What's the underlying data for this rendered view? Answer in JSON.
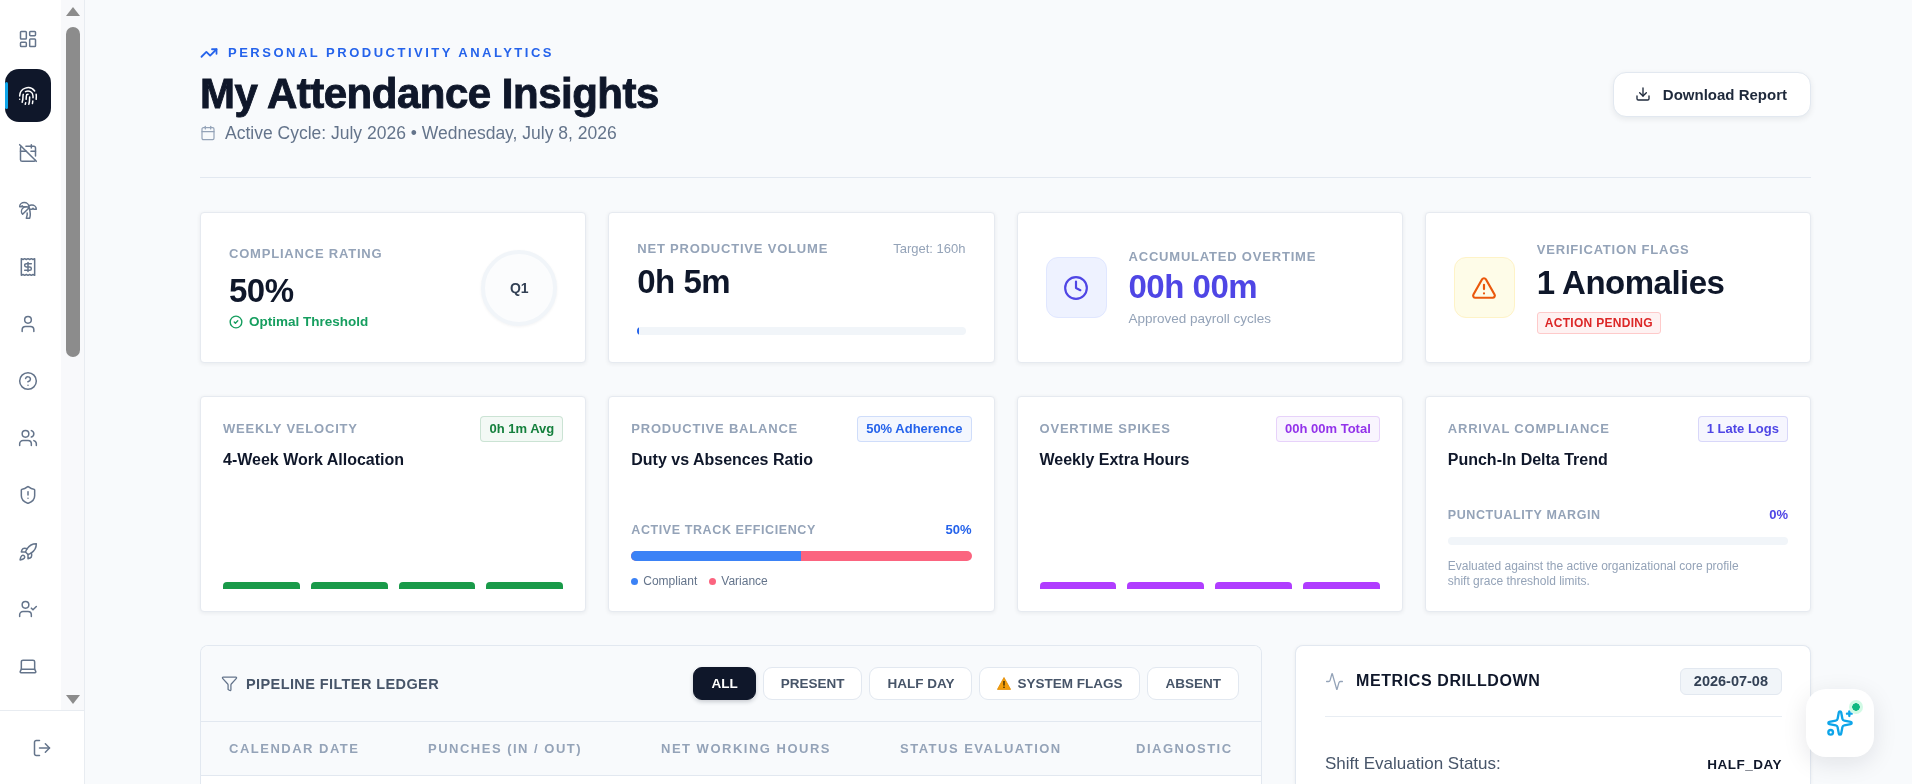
{
  "sidebar": {
    "nav_items": [
      {
        "selected": false
      },
      {
        "selected": true
      },
      {
        "selected": false
      },
      {
        "selected": false
      },
      {
        "selected": false
      },
      {
        "selected": false
      },
      {
        "selected": false
      },
      {
        "selected": false
      },
      {
        "selected": false
      },
      {
        "selected": false
      },
      {
        "selected": false
      },
      {
        "selected": false
      }
    ]
  },
  "header": {
    "eyebrow": "PERSONAL PRODUCTIVITY ANALYTICS",
    "title": "My Attendance Insights",
    "subtitle": "Active Cycle: July 2026 • Wednesday, July 8, 2026",
    "download_button": "Download Report"
  },
  "summary_cards": [
    {
      "kind": "rating",
      "label": "COMPLIANCE RATING",
      "value": "50%",
      "status": "Optimal Threshold",
      "ring": "Q1"
    },
    {
      "kind": "progress",
      "label": "NET PRODUCTIVE VOLUME",
      "target": "Target: 160h",
      "value": "0h 5m",
      "level": 0.006
    },
    {
      "kind": "note",
      "label": "ACCUMULATED OVERTIME",
      "value": "00h 00m",
      "note": "Approved payroll cycles"
    },
    {
      "kind": "alert",
      "label": "VERIFICATION FLAGS",
      "value": "1 Anomalies",
      "badge": "ACTION PENDING"
    }
  ],
  "trend_cards": [
    {
      "kind": "bars",
      "label": "WEEKLY VELOCITY",
      "badge": "0h 1m Avg",
      "color": "#15803d",
      "title": "4-Week Work Allocation"
    },
    {
      "kind": "split",
      "label": "PRODUCTIVE BALANCE",
      "badge": "50% Adherence",
      "color": "#2563eb",
      "title": "Duty vs Absences Ratio",
      "meter": {
        "label": "ACTIVE TRACK EFFICIENCY",
        "reading": "50%",
        "level": 0.5
      },
      "legend": [
        {
          "label": "Compliant",
          "color": "#3b82f6"
        },
        {
          "label": "Variance",
          "color": "#fb647f"
        }
      ]
    },
    {
      "kind": "bars",
      "label": "OVERTIME SPIKES",
      "badge": "00h 00m Total",
      "color": "#9333ea",
      "title": "Weekly Extra Hours"
    },
    {
      "kind": "margin",
      "label": "ARRIVAL COMPLIANCE",
      "badge": "1 Late Logs",
      "color": "#4f46e5",
      "title": "Punch-In Delta Trend",
      "meter": {
        "label": "PUNCTUALITY MARGIN",
        "reading": "0%"
      },
      "note": "Evaluated against the active organizational core profile shift grace threshold limits."
    }
  ],
  "ledger": {
    "title": "PIPELINE FILTER LEDGER",
    "filters": [
      {
        "label": "ALL",
        "kind": "plain",
        "selected": true
      },
      {
        "label": "PRESENT",
        "kind": "plain",
        "selected": false
      },
      {
        "label": "HALF DAY",
        "kind": "plain",
        "selected": false
      },
      {
        "label": "SYSTEM FLAGS",
        "kind": "warning",
        "selected": false
      },
      {
        "label": "ABSENT",
        "kind": "plain",
        "selected": false
      }
    ],
    "columns": [
      "CALENDAR DATE",
      "PUNCHES (IN / OUT)",
      "NET WORKING HOURS",
      "STATUS EVALUATION",
      "DIAGNOSTIC"
    ]
  },
  "drilldown": {
    "title": "METRICS DRILLDOWN",
    "date": "2026-07-08",
    "rows": [
      {
        "label": "Shift Evaluation Status:",
        "value": "HALF_DAY"
      }
    ]
  },
  "assistant_button": {
    "notification": true
  }
}
